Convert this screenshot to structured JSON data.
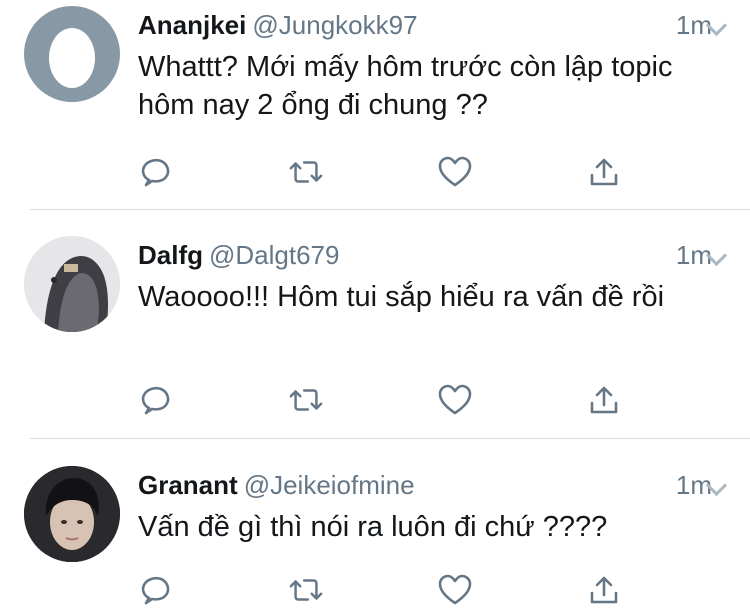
{
  "tweets": [
    {
      "name": "Ananjkei",
      "handle": "@Jungkokk97",
      "time": "1m",
      "text": "Whattt? Mới mấy hôm trước còn lập topic hôm nay 2 ổng đi chung ??",
      "avatar": "default-egg-avatar"
    },
    {
      "name": "Dalfg",
      "handle": "@Dalgt679",
      "time": "1m",
      "text": "Waoooo!!! Hôm tui sắp hiểu ra vấn đề rồi",
      "avatar": "person-in-jacket-avatar"
    },
    {
      "name": "Granant",
      "handle": "@Jeikeiofmine",
      "time": "1m",
      "text": "Vấn đề gì thì nói ra luôn đi chứ ????",
      "avatar": "young-man-portrait-avatar"
    }
  ],
  "icons": {
    "reply": "reply-icon",
    "retweet": "retweet-icon",
    "like": "heart-icon",
    "share": "share-icon",
    "menu": "chevron-down-icon"
  },
  "colors": {
    "text": "#14171a",
    "secondary": "#657786",
    "icon": "#657786",
    "divider": "#d9dee2",
    "egg_bg": "#8899a6"
  }
}
